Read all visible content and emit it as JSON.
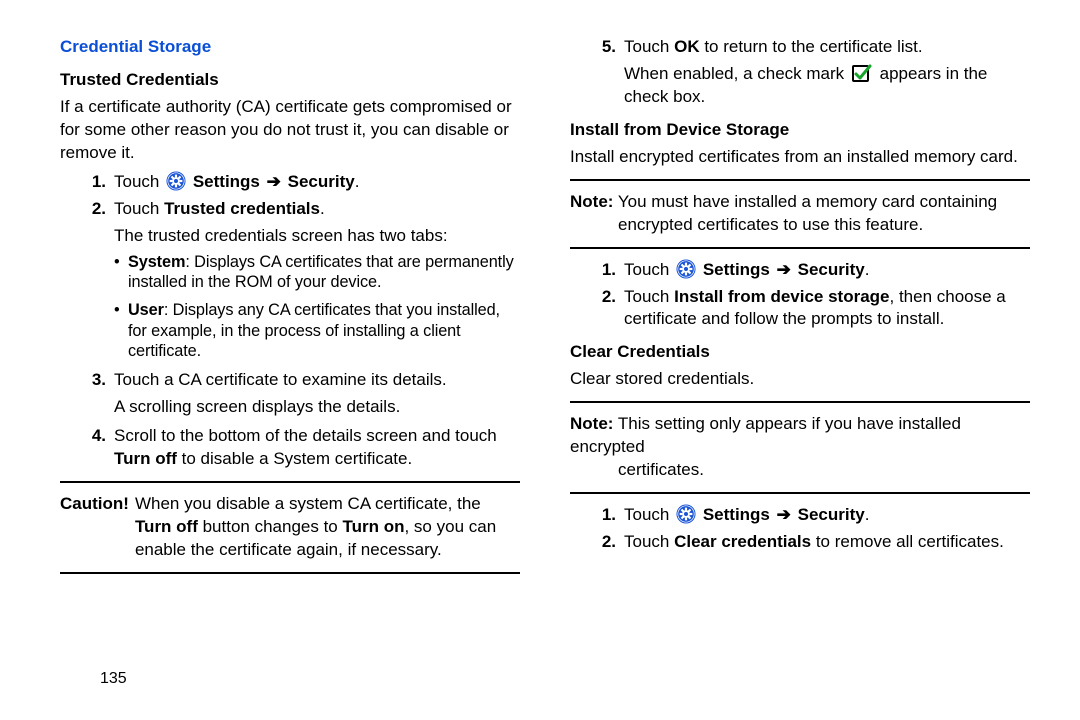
{
  "page_number": "135",
  "section_title": "Credential Storage",
  "left": {
    "trusted_heading": "Trusted Credentials",
    "intro": "If a certificate authority (CA) certificate gets compromised or for some other reason you do not trust it, you can disable or remove it.",
    "s1_n": "1.",
    "s1_touch": "Touch ",
    "s1_settings": "Settings",
    "s1_arrow": "➔",
    "s1_security": "Security",
    "s1_period": ".",
    "s2_n": "2.",
    "s2_touch": "Touch ",
    "s2_tc": "Trusted credentials",
    "s2_period": ".",
    "s2_tail": "The trusted credentials screen has two tabs:",
    "bullet_sys_label": "System",
    "bullet_sys_text": ": Displays CA certificates that are permanently installed in the ROM of your device.",
    "bullet_user_label": "User",
    "bullet_user_text": ": Displays any CA certificates that you installed, for example, in the process of installing a client certificate.",
    "s3_n": "3.",
    "s3_a": "Touch a CA certificate to examine its details.",
    "s3_b": "A scrolling screen displays the details.",
    "s4_n": "4.",
    "s4_a": "Scroll to the bottom of the details screen and touch ",
    "s4_b": "Turn off",
    "s4_c": " to disable a System certificate.",
    "caution_label": "Caution!",
    "caution_a": "When you disable a system CA certificate, the ",
    "caution_b": "Turn off",
    "caution_c": " button changes to ",
    "caution_d": "Turn on",
    "caution_e": ", so you can enable the certificate again, if necessary."
  },
  "right": {
    "s5_n": "5.",
    "s5_a": "Touch ",
    "s5_b": "OK",
    "s5_c": " to return to the certificate list.",
    "s5_d1": "When enabled, a check mark ",
    "s5_d2": " appears in the check box.",
    "install_heading": "Install from Device Storage",
    "install_intro": "Install encrypted certificates from an installed memory card.",
    "note1_label": "Note:",
    "note1_a": "You must have installed a memory card containing ",
    "note1_b": "encrypted certificates to use this feature.",
    "i1_n": "1.",
    "i1_touch": "Touch ",
    "i1_settings": "Settings",
    "i1_arrow": "➔",
    "i1_security": "Security",
    "i1_period": ".",
    "i2_n": "2.",
    "i2_a": "Touch ",
    "i2_b": "Install from device storage",
    "i2_c": ", then choose a certificate and follow the prompts to install.",
    "clear_heading": "Clear Credentials",
    "clear_intro": "Clear stored credentials.",
    "note2_label": "Note:",
    "note2_a": "This setting only appears if you have installed encrypted ",
    "note2_b": "certificates.",
    "c1_n": "1.",
    "c1_touch": "Touch ",
    "c1_settings": "Settings",
    "c1_arrow": "➔",
    "c1_security": "Security",
    "c1_period": ".",
    "c2_n": "2.",
    "c2_a": "Touch ",
    "c2_b": "Clear credentials",
    "c2_c": " to remove all certificates."
  }
}
